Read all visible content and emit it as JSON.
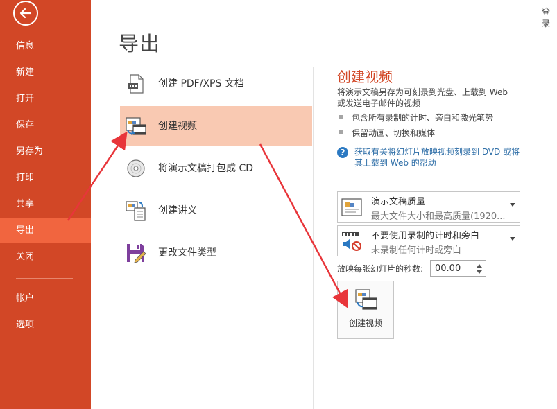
{
  "sidebar": {
    "items": [
      {
        "label": "信息"
      },
      {
        "label": "新建"
      },
      {
        "label": "打开"
      },
      {
        "label": "保存"
      },
      {
        "label": "另存为"
      },
      {
        "label": "打印"
      },
      {
        "label": "共享"
      },
      {
        "label": "导出"
      },
      {
        "label": "关闭"
      },
      {
        "label": "帐户"
      },
      {
        "label": "选项"
      }
    ],
    "active_item": "导出",
    "accent_color": "#d24726",
    "active_color": "#f1653f"
  },
  "header": {
    "signin_label": "登录"
  },
  "page_title": "导出",
  "export_options": [
    {
      "label": "创建 PDF/XPS 文档",
      "icon": "pdf-document-icon"
    },
    {
      "label": "创建视频",
      "icon": "create-video-icon"
    },
    {
      "label": "将演示文稿打包成 CD",
      "icon": "cd-disc-icon"
    },
    {
      "label": "创建讲义",
      "icon": "handout-icon"
    },
    {
      "label": "更改文件类型",
      "icon": "save-floppy-icon"
    }
  ],
  "detail": {
    "title": "创建视频",
    "description": "将演示文稿另存为可刻录到光盘、上载到 Web 或发送电子邮件的视频",
    "bullets": [
      "包含所有录制的计时、旁白和激光笔势",
      "保留动画、切换和媒体"
    ],
    "help_link": "获取有关将幻灯片放映视频刻录到 DVD 或将其上载到 Web 的帮助",
    "quality_dropdown": {
      "main": "演示文稿质量",
      "sub": "最大文件大小和最高质量(1920..."
    },
    "timing_dropdown": {
      "main": "不要使用录制的计时和旁白",
      "sub": "未录制任何计时或旁白"
    },
    "seconds_label": "放映每张幻灯片的秒数:",
    "seconds_value": "00.00",
    "create_button_label": "创建视频"
  }
}
